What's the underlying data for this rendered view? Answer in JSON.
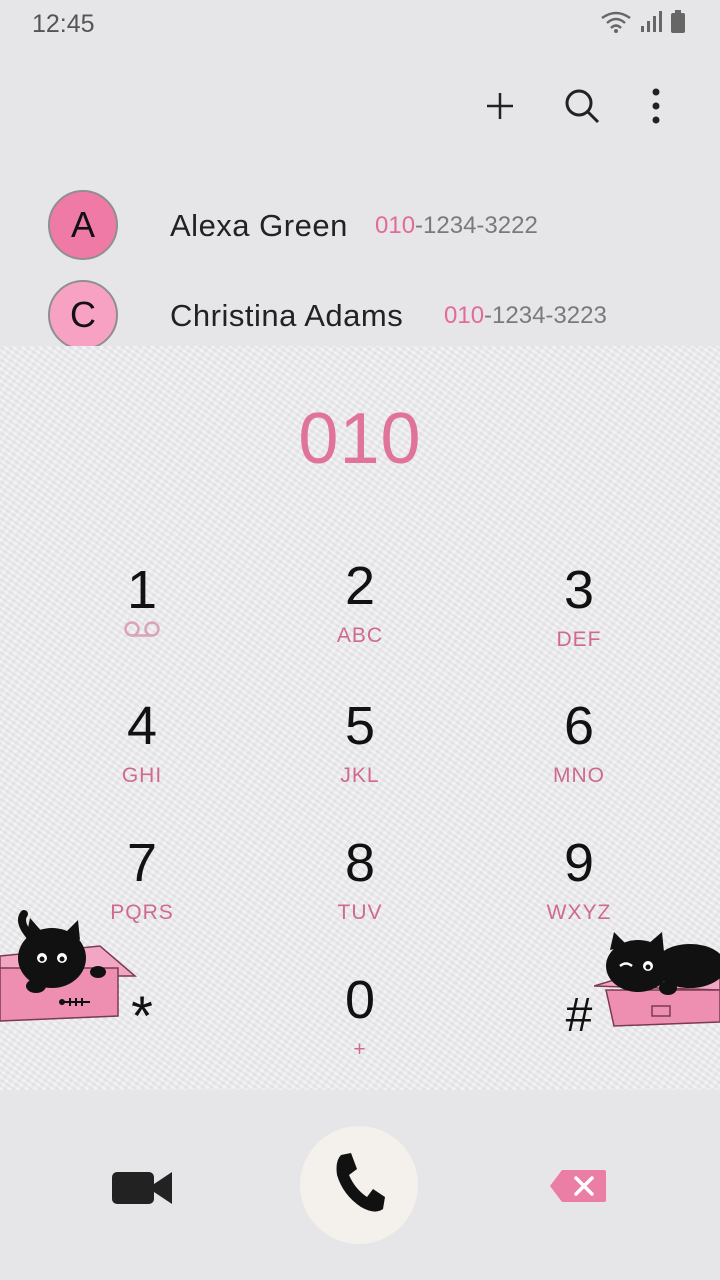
{
  "status": {
    "time": "12:45"
  },
  "contacts": [
    {
      "initial": "A",
      "name": "Alexa Green",
      "number_match": "010",
      "number_rest": "-1234-3222",
      "avatar_color": "#f07aa6"
    },
    {
      "initial": "C",
      "name": "Christina Adams",
      "number_match": "010",
      "number_rest": "-1234-3223",
      "avatar_color": "#f7a2c2"
    }
  ],
  "dialer": {
    "typed": "010"
  },
  "keys": [
    {
      "digit": "1",
      "letters": ""
    },
    {
      "digit": "2",
      "letters": "ABC"
    },
    {
      "digit": "3",
      "letters": "DEF"
    },
    {
      "digit": "4",
      "letters": "GHI"
    },
    {
      "digit": "5",
      "letters": "JKL"
    },
    {
      "digit": "6",
      "letters": "MNO"
    },
    {
      "digit": "7",
      "letters": "PQRS"
    },
    {
      "digit": "8",
      "letters": "TUV"
    },
    {
      "digit": "9",
      "letters": "WXYZ"
    },
    {
      "digit": "*",
      "letters": ""
    },
    {
      "digit": "0",
      "letters": "+"
    },
    {
      "digit": "#",
      "letters": ""
    }
  ],
  "icons": {
    "add": "plus-icon",
    "search": "search-icon",
    "more": "more-vertical-icon",
    "video": "video-call-icon",
    "call": "phone-icon",
    "delete": "backspace-icon",
    "voicemail": "voicemail-icon"
  },
  "colors": {
    "accent": "#e07399",
    "background": "#e6e6e9",
    "call_button": "#f4f0ec"
  }
}
